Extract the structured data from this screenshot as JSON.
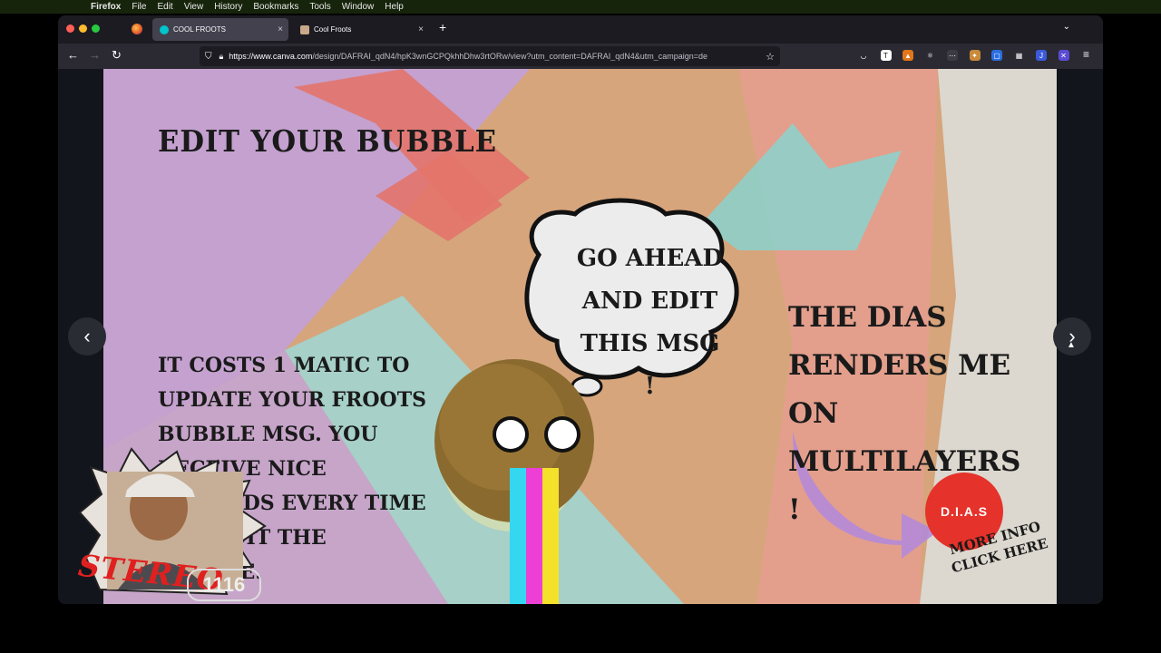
{
  "menubar": {
    "app": "Firefox",
    "items": [
      "File",
      "Edit",
      "View",
      "History",
      "Bookmarks",
      "Tools",
      "Window",
      "Help"
    ]
  },
  "tabs": [
    {
      "title": "COOL FROOTS",
      "active": true,
      "close": "×"
    },
    {
      "title": "Cool Froots",
      "active": false,
      "close": "×"
    }
  ],
  "toolbar": {
    "new_tab": "+",
    "list_all_tabs": "⌄",
    "back": "←",
    "forward": "→",
    "reload": "↻",
    "url_host": "https://www.canva.com",
    "url_path": "/design/DAFRAI_qdN4/hpK3wnGCPQkhhDhw3rtORw/view?utm_content=DAFRAI_qdN4&utm_campaign=de",
    "menu": "≡"
  },
  "extensions": [
    {
      "name": "pocket-icon",
      "color": "#2b2a33",
      "glyph": "◡"
    },
    {
      "name": "t-extension-icon",
      "color": "#ffffff",
      "glyph": "T"
    },
    {
      "name": "metamask-icon",
      "color": "#e2761b",
      "glyph": "▲"
    },
    {
      "name": "react-icon",
      "color": "#2b2a33",
      "glyph": "⚛"
    },
    {
      "name": "dots-extension-icon",
      "color": "#3c3b45",
      "glyph": "⋯"
    },
    {
      "name": "fox-extension-icon",
      "color": "#c98a3a",
      "glyph": "✦"
    },
    {
      "name": "blue-square-icon",
      "color": "#2a6ee0",
      "glyph": "▢"
    },
    {
      "name": "calendar-icon",
      "color": "#2b2a33",
      "glyph": "▦"
    },
    {
      "name": "j-extension-icon",
      "color": "#3b5bdb",
      "glyph": "J"
    },
    {
      "name": "purple-extension-icon",
      "color": "#5b4bd5",
      "glyph": "✕"
    }
  ],
  "slide": {
    "title": "EDIT YOUR BUBBLE",
    "cost_text": "IT COSTS 1 MATIC TO UPDATE YOUR FROOTS BUBBLE MSG. YOU RECEIVE NICE REWARDS EVERY TIME YOU EDIT THE BUBBLE.",
    "bubble_message": "GO AHEAD AND EDIT THIS MSG !",
    "dias_text": "THE DIAS RENDERS ME ON MULTILAYERS !",
    "badge_label": "D.I.A.S",
    "more_info": "MORE INFO CLICK HERE"
  },
  "overlay": {
    "brand": "STEREO",
    "brand_number": "1116"
  },
  "nav": {
    "prev": "‹",
    "next": "›"
  }
}
